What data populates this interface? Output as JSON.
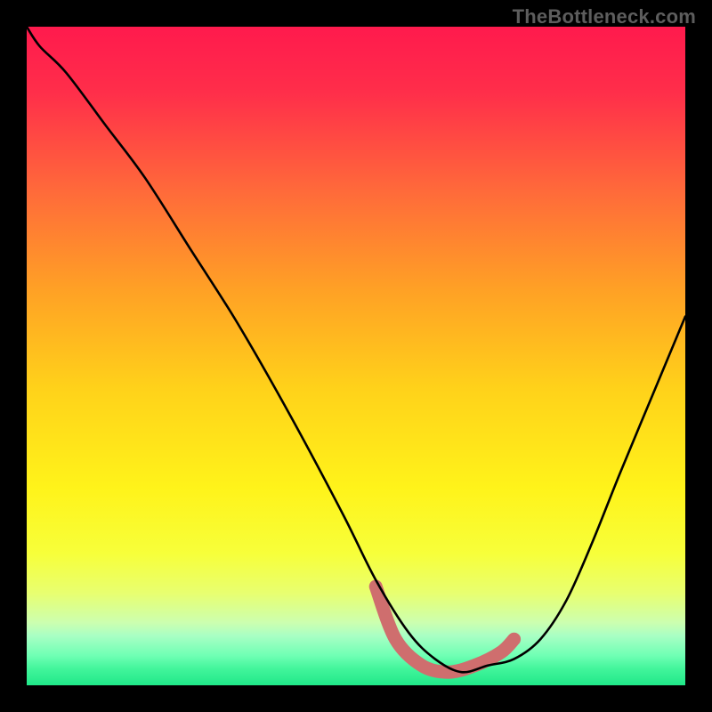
{
  "watermark": "TheBottleneck.com",
  "gradient_stops": [
    {
      "offset": 0.0,
      "color": "#ff1a4d"
    },
    {
      "offset": 0.1,
      "color": "#ff2e4a"
    },
    {
      "offset": 0.25,
      "color": "#ff6a3a"
    },
    {
      "offset": 0.4,
      "color": "#ffa125"
    },
    {
      "offset": 0.55,
      "color": "#ffd21a"
    },
    {
      "offset": 0.7,
      "color": "#fff31a"
    },
    {
      "offset": 0.8,
      "color": "#f7ff3a"
    },
    {
      "offset": 0.86,
      "color": "#e8ff70"
    },
    {
      "offset": 0.905,
      "color": "#ccffb0"
    },
    {
      "offset": 0.925,
      "color": "#a8ffc4"
    },
    {
      "offset": 0.955,
      "color": "#6fffb4"
    },
    {
      "offset": 0.975,
      "color": "#42f59b"
    },
    {
      "offset": 1.0,
      "color": "#20e889"
    }
  ],
  "chart_data": {
    "type": "line",
    "title": "",
    "xlabel": "",
    "ylabel": "",
    "xlim": [
      0,
      100
    ],
    "ylim": [
      0,
      100
    ],
    "series": [
      {
        "name": "main-curve",
        "color": "#000000",
        "x": [
          0,
          2,
          6,
          12,
          18,
          25,
          32,
          40,
          48,
          53,
          58,
          62,
          66,
          70,
          74,
          78,
          82,
          86,
          90,
          95,
          100
        ],
        "values": [
          100,
          97,
          93,
          85,
          77,
          66,
          55,
          41,
          26,
          16,
          8,
          4,
          2,
          3,
          4,
          7,
          13,
          22,
          32,
          44,
          56
        ]
      },
      {
        "name": "flat-highlight",
        "color": "#cf6e6e",
        "x": [
          53,
          56,
          60,
          64,
          68,
          72,
          74
        ],
        "values": [
          15,
          7,
          3,
          2,
          3,
          5,
          7
        ]
      }
    ]
  }
}
